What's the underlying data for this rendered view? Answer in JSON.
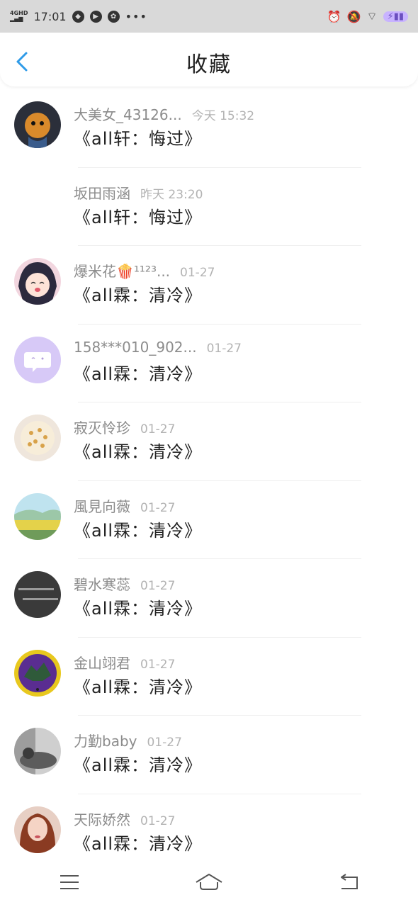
{
  "status_bar": {
    "network": "4GHD",
    "time": "17:01",
    "dots": "•••"
  },
  "header": {
    "title": "收藏"
  },
  "items": [
    {
      "name": "大美女_43126...",
      "time": "今天 15:32",
      "title": "《all轩：悔过》",
      "avatar": "tiger-avatar"
    },
    {
      "name": "坂田雨涵",
      "time": "昨天 23:20",
      "title": "《all轩：悔过》",
      "avatar": "none"
    },
    {
      "name": "爆米花🍿¹¹²³...",
      "time": "01-27",
      "title": "《all霖：清冷》",
      "avatar": "anime-girl-avatar"
    },
    {
      "name": "158***010_902...",
      "time": "01-27",
      "title": "《all霖：清冷》",
      "avatar": "default-avatar"
    },
    {
      "name": "寂灭怜珍",
      "time": "01-27",
      "title": "《all霖：清冷》",
      "avatar": "seashell-avatar"
    },
    {
      "name": "風見向薇",
      "time": "01-27",
      "title": "《all霖：清冷》",
      "avatar": "landscape-avatar"
    },
    {
      "name": "碧水寒蕊",
      "time": "01-27",
      "title": "《all霖：清冷》",
      "avatar": "dark-text-avatar"
    },
    {
      "name": "金山翊君",
      "time": "01-27",
      "title": "《all霖：清冷》",
      "avatar": "emblem-avatar"
    },
    {
      "name": "力勤baby",
      "time": "01-27",
      "title": "《all霖：清冷》",
      "avatar": "bw-photo-avatar"
    },
    {
      "name": "天际娇然",
      "time": "01-27",
      "title": "《all霖：清冷》",
      "avatar": "portrait-avatar"
    }
  ],
  "colors": {
    "accent": "#2f9be8",
    "status_bg": "#d9d9d9",
    "name_gray": "#8c8c8c",
    "time_gray": "#b3b3b3"
  }
}
